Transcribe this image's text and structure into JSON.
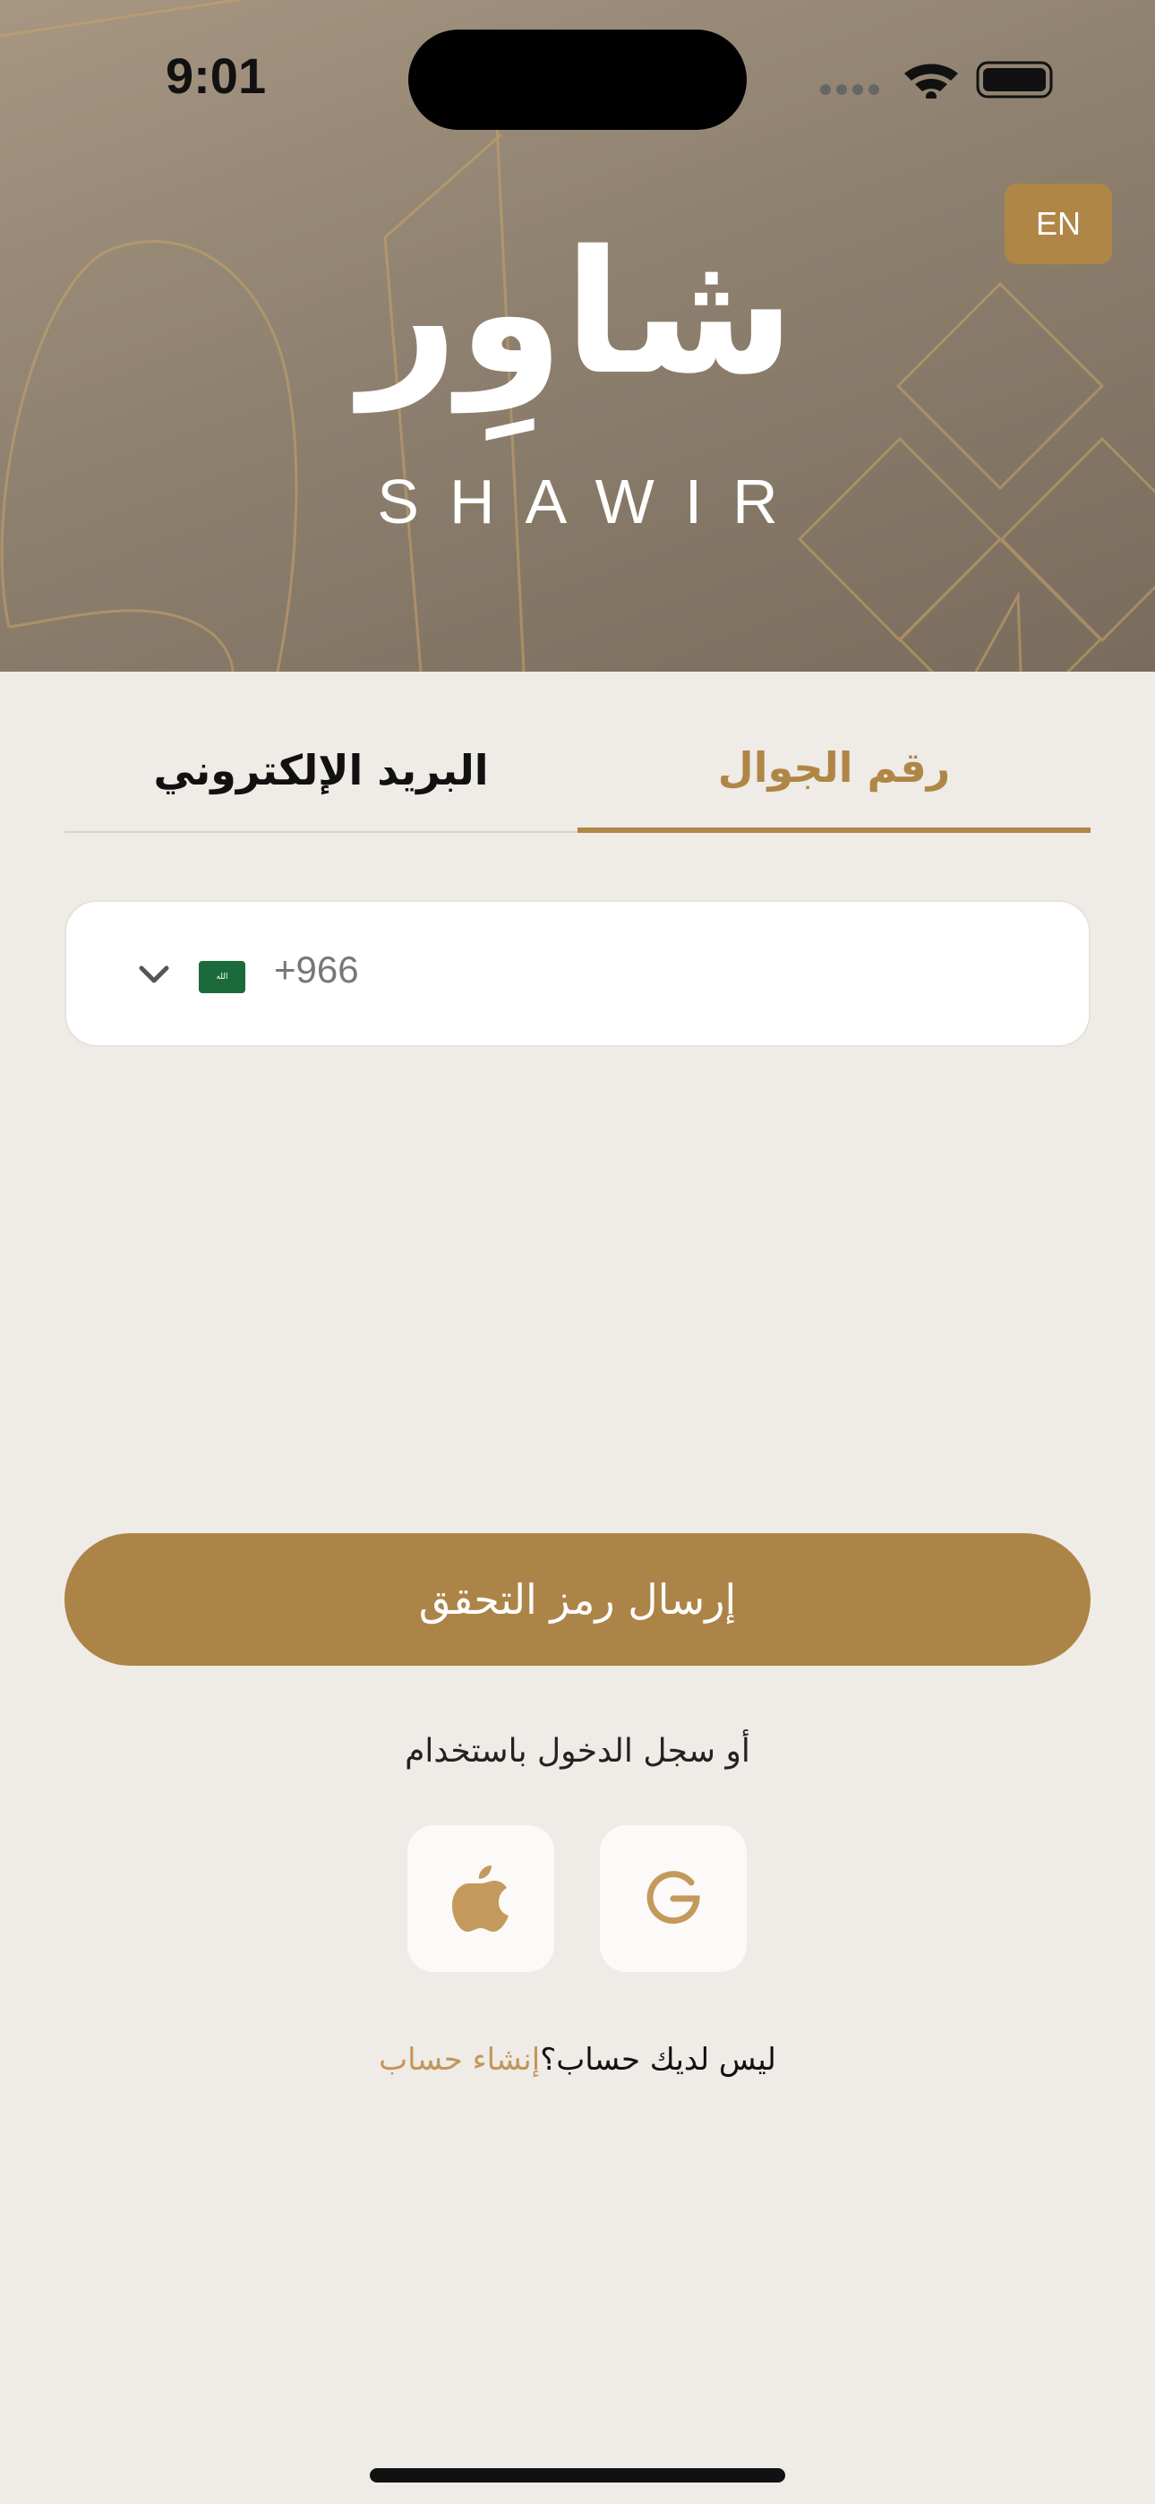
{
  "status_bar": {
    "time": "9:01"
  },
  "header": {
    "language_button": "EN",
    "logo_arabic": "شاوِر",
    "logo_english": "SHAWIR"
  },
  "tabs": {
    "phone": "رقم الجوال",
    "email": "البريد الإلكتروني",
    "active": "phone"
  },
  "phone_field": {
    "country_code": "+966",
    "flag_text": "الله"
  },
  "send_button": "إرسال رمز التحقق",
  "social": {
    "or_text": "أو سجل الدخول باستخدام",
    "apple_icon": "apple-icon",
    "google_icon": "google-icon"
  },
  "signup": {
    "prompt": "ليس لديك حساب؟",
    "link": "إنشاء حساب"
  },
  "colors": {
    "accent": "#b08646",
    "background": "#efebe7",
    "header": "#8f8170"
  }
}
